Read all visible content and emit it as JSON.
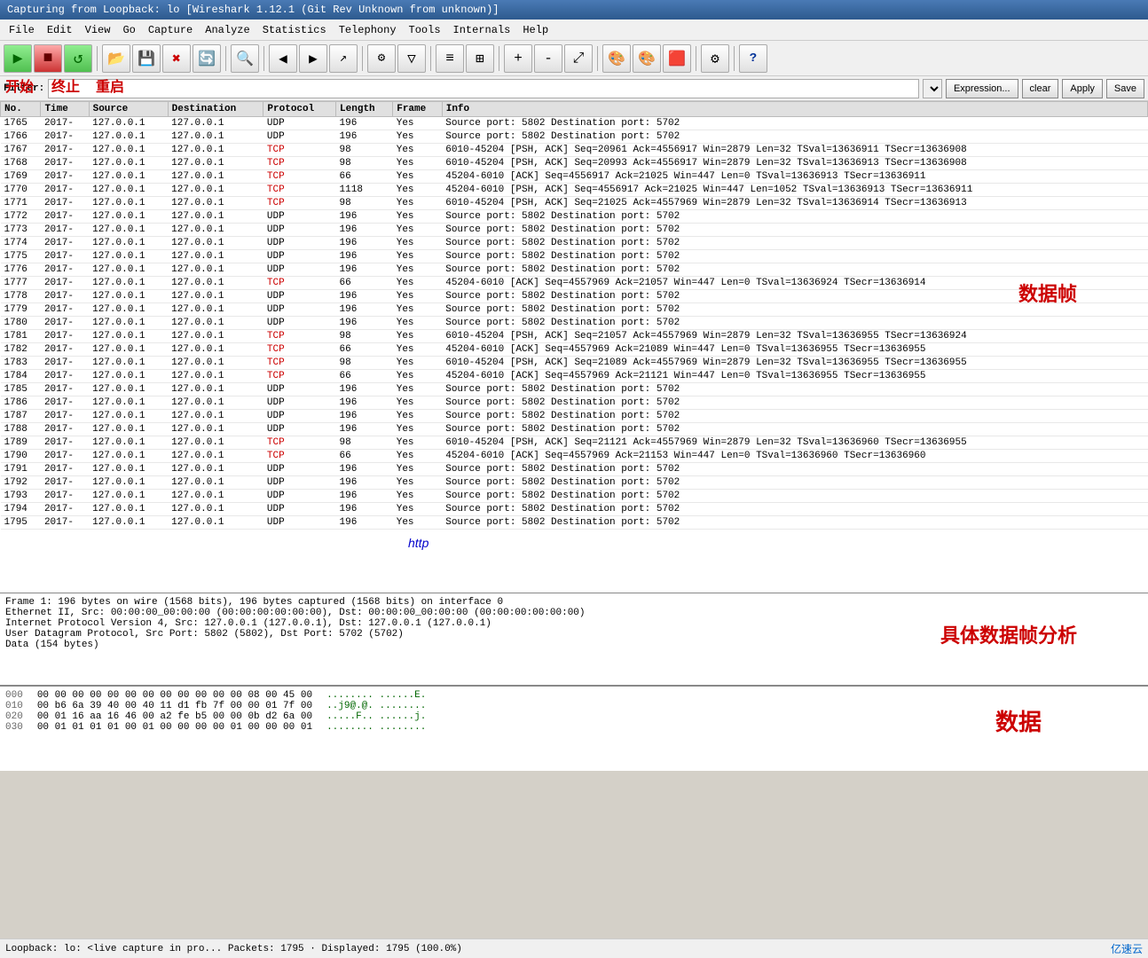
{
  "title_bar": {
    "text": "Capturing from Loopback: lo   [Wireshark 1.12.1 (Git Rev Unknown from unknown)]"
  },
  "menu": {
    "items": [
      "File",
      "Edit",
      "View",
      "Go",
      "Capture",
      "Analyze",
      "Statistics",
      "Telephony",
      "Tools",
      "Internals",
      "Help"
    ]
  },
  "toolbar": {
    "buttons": [
      {
        "name": "start-capture",
        "icon": "▶",
        "label": "开始"
      },
      {
        "name": "stop-capture",
        "icon": "■",
        "label": "终止"
      },
      {
        "name": "restart-capture",
        "icon": "↺",
        "label": "重启"
      },
      {
        "name": "open-file",
        "icon": "📂",
        "label": ""
      },
      {
        "name": "save-file",
        "icon": "💾",
        "label": ""
      },
      {
        "name": "close",
        "icon": "✖",
        "label": ""
      },
      {
        "name": "reload",
        "icon": "🔄",
        "label": ""
      },
      {
        "name": "find",
        "icon": "🔍",
        "label": ""
      },
      {
        "name": "prev",
        "icon": "◀",
        "label": ""
      },
      {
        "name": "next",
        "icon": "▶",
        "label": ""
      },
      {
        "name": "goto",
        "icon": "↗",
        "label": ""
      },
      {
        "name": "capture-options",
        "icon": "⚙",
        "label": ""
      },
      {
        "name": "capture-start2",
        "icon": "▽",
        "label": ""
      },
      {
        "name": "pkt-list",
        "icon": "≡",
        "label": ""
      },
      {
        "name": "pkt-detail",
        "icon": "⊞",
        "label": ""
      },
      {
        "name": "zoom-in",
        "icon": "+",
        "label": ""
      },
      {
        "name": "zoom-out",
        "icon": "-",
        "label": ""
      },
      {
        "name": "resize",
        "icon": "⤢",
        "label": ""
      },
      {
        "name": "coloring",
        "icon": "🎨",
        "label": ""
      },
      {
        "name": "coloring2",
        "icon": "🎨",
        "label": ""
      },
      {
        "name": "color3",
        "icon": "🟥",
        "label": ""
      },
      {
        "name": "prefs",
        "icon": "⚙",
        "label": ""
      },
      {
        "name": "help-btn",
        "icon": "?",
        "label": ""
      }
    ],
    "annotations": {
      "start": "开始",
      "stop": "终止",
      "restart": "重启"
    }
  },
  "filter_bar": {
    "label": "Filter:",
    "placeholder": "",
    "expression_btn": "Expression...",
    "clear_btn": "clear",
    "apply_btn": "Apply",
    "save_btn": "Save"
  },
  "packet_list": {
    "columns": [
      "No.",
      "Time",
      "Source",
      "Destination",
      "Protocol",
      "Length",
      "Frame",
      "Info"
    ],
    "rows": [
      {
        "no": "1765",
        "time": "2017-",
        "src": "127.0.0.1",
        "dst": "127.0.0.1",
        "proto": "UDP",
        "len": "196",
        "frame": "Yes",
        "info": "Source port: 5802  Destination port: 5702"
      },
      {
        "no": "1766",
        "time": "2017-",
        "src": "127.0.0.1",
        "dst": "127.0.0.1",
        "proto": "UDP",
        "len": "196",
        "frame": "Yes",
        "info": "Source port: 5802  Destination port: 5702"
      },
      {
        "no": "1767",
        "time": "2017-",
        "src": "127.0.0.1",
        "dst": "127.0.0.1",
        "proto": "TCP",
        "len": "98",
        "frame": "Yes",
        "info": "6010-45204 [PSH, ACK] Seq=20961 Ack=4556917 Win=2879 Len=32 TSval=13636911 TSecr=13636908"
      },
      {
        "no": "1768",
        "time": "2017-",
        "src": "127.0.0.1",
        "dst": "127.0.0.1",
        "proto": "TCP",
        "len": "98",
        "frame": "Yes",
        "info": "6010-45204 [PSH, ACK] Seq=20993 Ack=4556917 Win=2879 Len=32 TSval=13636913 TSecr=13636908"
      },
      {
        "no": "1769",
        "time": "2017-",
        "src": "127.0.0.1",
        "dst": "127.0.0.1",
        "proto": "TCP",
        "len": "66",
        "frame": "Yes",
        "info": "45204-6010 [ACK] Seq=4556917 Ack=21025 Win=447 Len=0 TSval=13636913 TSecr=13636911"
      },
      {
        "no": "1770",
        "time": "2017-",
        "src": "127.0.0.1",
        "dst": "127.0.0.1",
        "proto": "TCP",
        "len": "1118",
        "frame": "Yes",
        "info": "45204-6010 [PSH, ACK] Seq=4556917 Ack=21025 Win=447 Len=1052 TSval=13636913 TSecr=13636911"
      },
      {
        "no": "1771",
        "time": "2017-",
        "src": "127.0.0.1",
        "dst": "127.0.0.1",
        "proto": "TCP",
        "len": "98",
        "frame": "Yes",
        "info": "6010-45204 [PSH, ACK] Seq=21025 Ack=4557969 Win=2879 Len=32 TSval=13636914 TSecr=13636913"
      },
      {
        "no": "1772",
        "time": "2017-",
        "src": "127.0.0.1",
        "dst": "127.0.0.1",
        "proto": "UDP",
        "len": "196",
        "frame": "Yes",
        "info": "Source port: 5802  Destination port: 5702"
      },
      {
        "no": "1773",
        "time": "2017-",
        "src": "127.0.0.1",
        "dst": "127.0.0.1",
        "proto": "UDP",
        "len": "196",
        "frame": "Yes",
        "info": "Source port: 5802  Destination port: 5702"
      },
      {
        "no": "1774",
        "time": "2017-",
        "src": "127.0.0.1",
        "dst": "127.0.0.1",
        "proto": "UDP",
        "len": "196",
        "frame": "Yes",
        "info": "Source port: 5802  Destination port: 5702"
      },
      {
        "no": "1775",
        "time": "2017-",
        "src": "127.0.0.1",
        "dst": "127.0.0.1",
        "proto": "UDP",
        "len": "196",
        "frame": "Yes",
        "info": "Source port: 5802  Destination port: 5702"
      },
      {
        "no": "1776",
        "time": "2017-",
        "src": "127.0.0.1",
        "dst": "127.0.0.1",
        "proto": "UDP",
        "len": "196",
        "frame": "Yes",
        "info": "Source port: 5802  Destination port: 5702"
      },
      {
        "no": "1777",
        "time": "2017-",
        "src": "127.0.0.1",
        "dst": "127.0.0.1",
        "proto": "TCP",
        "len": "66",
        "frame": "Yes",
        "info": "45204-6010 [ACK] Seq=4557969 Ack=21057 Win=447 Len=0 TSval=13636924 TSecr=13636914"
      },
      {
        "no": "1778",
        "time": "2017-",
        "src": "127.0.0.1",
        "dst": "127.0.0.1",
        "proto": "UDP",
        "len": "196",
        "frame": "Yes",
        "info": "Source port: 5802  Destination port: 5702"
      },
      {
        "no": "1779",
        "time": "2017-",
        "src": "127.0.0.1",
        "dst": "127.0.0.1",
        "proto": "UDP",
        "len": "196",
        "frame": "Yes",
        "info": "Source port: 5802  Destination port: 5702"
      },
      {
        "no": "1780",
        "time": "2017-",
        "src": "127.0.0.1",
        "dst": "127.0.0.1",
        "proto": "UDP",
        "len": "196",
        "frame": "Yes",
        "info": "Source port: 5802  Destination port: 5702"
      },
      {
        "no": "1781",
        "time": "2017-",
        "src": "127.0.0.1",
        "dst": "127.0.0.1",
        "proto": "TCP",
        "len": "98",
        "frame": "Yes",
        "info": "6010-45204 [PSH, ACK] Seq=21057 Ack=4557969 Win=2879 Len=32 TSval=13636955 TSecr=13636924"
      },
      {
        "no": "1782",
        "time": "2017-",
        "src": "127.0.0.1",
        "dst": "127.0.0.1",
        "proto": "TCP",
        "len": "66",
        "frame": "Yes",
        "info": "45204-6010 [ACK] Seq=4557969 Ack=21089 Win=447 Len=0 TSval=13636955 TSecr=13636955"
      },
      {
        "no": "1783",
        "time": "2017-",
        "src": "127.0.0.1",
        "dst": "127.0.0.1",
        "proto": "TCP",
        "len": "98",
        "frame": "Yes",
        "info": "6010-45204 [PSH, ACK] Seq=21089 Ack=4557969 Win=2879 Len=32 TSval=13636955 TSecr=13636955"
      },
      {
        "no": "1784",
        "time": "2017-",
        "src": "127.0.0.1",
        "dst": "127.0.0.1",
        "proto": "TCP",
        "len": "66",
        "frame": "Yes",
        "info": "45204-6010 [ACK] Seq=4557969 Ack=21121 Win=447 Len=0 TSval=13636955 TSecr=13636955"
      },
      {
        "no": "1785",
        "time": "2017-",
        "src": "127.0.0.1",
        "dst": "127.0.0.1",
        "proto": "UDP",
        "len": "196",
        "frame": "Yes",
        "info": "Source port: 5802  Destination port: 5702"
      },
      {
        "no": "1786",
        "time": "2017-",
        "src": "127.0.0.1",
        "dst": "127.0.0.1",
        "proto": "UDP",
        "len": "196",
        "frame": "Yes",
        "info": "Source port: 5802  Destination port: 5702"
      },
      {
        "no": "1787",
        "time": "2017-",
        "src": "127.0.0.1",
        "dst": "127.0.0.1",
        "proto": "UDP",
        "len": "196",
        "frame": "Yes",
        "info": "Source port: 5802  Destination port: 5702"
      },
      {
        "no": "1788",
        "time": "2017-",
        "src": "127.0.0.1",
        "dst": "127.0.0.1",
        "proto": "UDP",
        "len": "196",
        "frame": "Yes",
        "info": "Source port: 5802  Destination port: 5702"
      },
      {
        "no": "1789",
        "time": "2017-",
        "src": "127.0.0.1",
        "dst": "127.0.0.1",
        "proto": "TCP",
        "len": "98",
        "frame": "Yes",
        "info": "6010-45204 [PSH, ACK] Seq=21121 Ack=4557969 Win=2879 Len=32 TSval=13636960 TSecr=13636955"
      },
      {
        "no": "1790",
        "time": "2017-",
        "src": "127.0.0.1",
        "dst": "127.0.0.1",
        "proto": "TCP",
        "len": "66",
        "frame": "Yes",
        "info": "45204-6010 [ACK] Seq=4557969 Ack=21153 Win=447 Len=0 TSval=13636960 TSecr=13636960"
      },
      {
        "no": "1791",
        "time": "2017-",
        "src": "127.0.0.1",
        "dst": "127.0.0.1",
        "proto": "UDP",
        "len": "196",
        "frame": "Yes",
        "info": "Source port: 5802  Destination port: 5702"
      },
      {
        "no": "1792",
        "time": "2017-",
        "src": "127.0.0.1",
        "dst": "127.0.0.1",
        "proto": "UDP",
        "len": "196",
        "frame": "Yes",
        "info": "Source port: 5802  Destination port: 5702"
      },
      {
        "no": "1793",
        "time": "2017-",
        "src": "127.0.0.1",
        "dst": "127.0.0.1",
        "proto": "UDP",
        "len": "196",
        "frame": "Yes",
        "info": "Source port: 5802  Destination port: 5702"
      },
      {
        "no": "1794",
        "time": "2017-",
        "src": "127.0.0.1",
        "dst": "127.0.0.1",
        "proto": "UDP",
        "len": "196",
        "frame": "Yes",
        "info": "Source port: 5802  Destination port: 5702"
      },
      {
        "no": "1795",
        "time": "2017-",
        "src": "127.0.0.1",
        "dst": "127.0.0.1",
        "proto": "UDP",
        "len": "196",
        "frame": "Yes",
        "info": "Source port: 5802  Destination port: 5702"
      }
    ]
  },
  "annotations": {
    "start_label": "开始",
    "stop_label": "终止",
    "restart_label": "重启",
    "frame_label": "数据帧",
    "http_label": "http",
    "detail_label": "具体数据帧分析",
    "data_label": "数据"
  },
  "details_panel": {
    "lines": [
      "Frame 1: 196 bytes on wire (1568 bits), 196 bytes captured (1568 bits) on interface 0",
      "Ethernet II, Src: 00:00:00_00:00:00 (00:00:00:00:00:00), Dst: 00:00:00_00:00:00 (00:00:00:00:00:00)",
      "Internet Protocol Version 4, Src: 127.0.0.1 (127.0.0.1), Dst: 127.0.0.1 (127.0.0.1)",
      "User Datagram Protocol, Src Port: 5802 (5802), Dst Port: 5702 (5702)",
      "Data (154 bytes)"
    ]
  },
  "hex_panel": {
    "rows": [
      {
        "offset": "000",
        "hex": "00 00 00 00 00 00 00 00   00 00 00 00 08 00 45 00",
        "ascii": "........ ......E."
      },
      {
        "offset": "010",
        "hex": "00 b6 6a 39 40 00 40 11   d1 fb 7f 00 00 01 7f 00",
        "ascii": "..j9@.@. ........"
      },
      {
        "offset": "020",
        "hex": "00 01 16 aa 16 46 00 a2   fe b5 00 00 0b d2 6a 00",
        "ascii": ".....F.. ......j."
      },
      {
        "offset": "030",
        "hex": "00 01 01 01 01 00 01 00   00 00 00 01 00 00 00 01",
        "ascii": "........ ........"
      }
    ]
  },
  "status_bar": {
    "text": "Loopback: lo: <live capture in pro...    Packets: 1795 · Displayed: 1795 (100.0%)"
  },
  "watermark": {
    "text": "亿速云"
  }
}
